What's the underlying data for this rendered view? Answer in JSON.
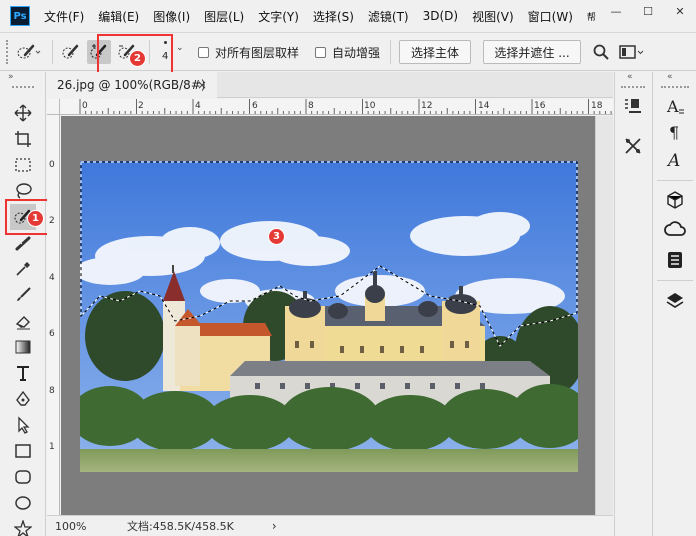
{
  "app": {
    "logo": "Ps"
  },
  "menu": [
    "文件(F)",
    "编辑(E)",
    "图像(I)",
    "图层(L)",
    "文字(Y)",
    "选择(S)",
    "滤镜(T)",
    "3D(D)",
    "视图(V)",
    "窗口(W)",
    "帮"
  ],
  "window_controls": {
    "minimize": "—",
    "maximize": "☐",
    "close": "✕"
  },
  "options": {
    "brush_size": "4",
    "sample_all_layers": "对所有图层取样",
    "auto_enhance": "自动增强",
    "select_subject": "选择主体",
    "select_and_mask": "选择并遮住 ..."
  },
  "document": {
    "tab_title": "26.jpg @ 100%(RGB/8#)",
    "tab_close": "×",
    "zoom": "100%",
    "doc_info": "文档:458.5K/458.5K",
    "status_arrow": "›"
  },
  "ruler": {
    "top_ticks": [
      "0",
      "2",
      "4",
      "6",
      "8",
      "10",
      "12",
      "14",
      "16",
      "18"
    ],
    "left_ticks": [
      "0",
      "2",
      "4",
      "6",
      "8",
      "1"
    ]
  },
  "annotations": {
    "badge1": "1",
    "badge2": "2",
    "badge3": "3"
  },
  "colors": {
    "highlight": "#e33",
    "badge": "#e53935",
    "canvas_bg": "#7d7d7d",
    "sky": "#4f86e0"
  },
  "icons": {
    "toolbar": [
      "move-icon",
      "artboard-icon",
      "marquee-icon",
      "lasso-icon",
      "quick-selection-icon",
      "healing-icon",
      "eyedropper-icon",
      "brush-icon",
      "eraser-icon",
      "gradient-icon",
      "type-icon",
      "pen-icon",
      "path-select-icon",
      "rectangle-icon",
      "rounded-rect-icon",
      "ellipse-icon",
      "custom-shape-icon"
    ],
    "panel1": [
      "properties-icon",
      "adjust-icon"
    ],
    "panel2": [
      "character-icon",
      "paragraph-icon",
      "glyphs-icon",
      "3d-icon",
      "creative-cloud-icon",
      "libraries-icon",
      "layers-icon"
    ]
  }
}
